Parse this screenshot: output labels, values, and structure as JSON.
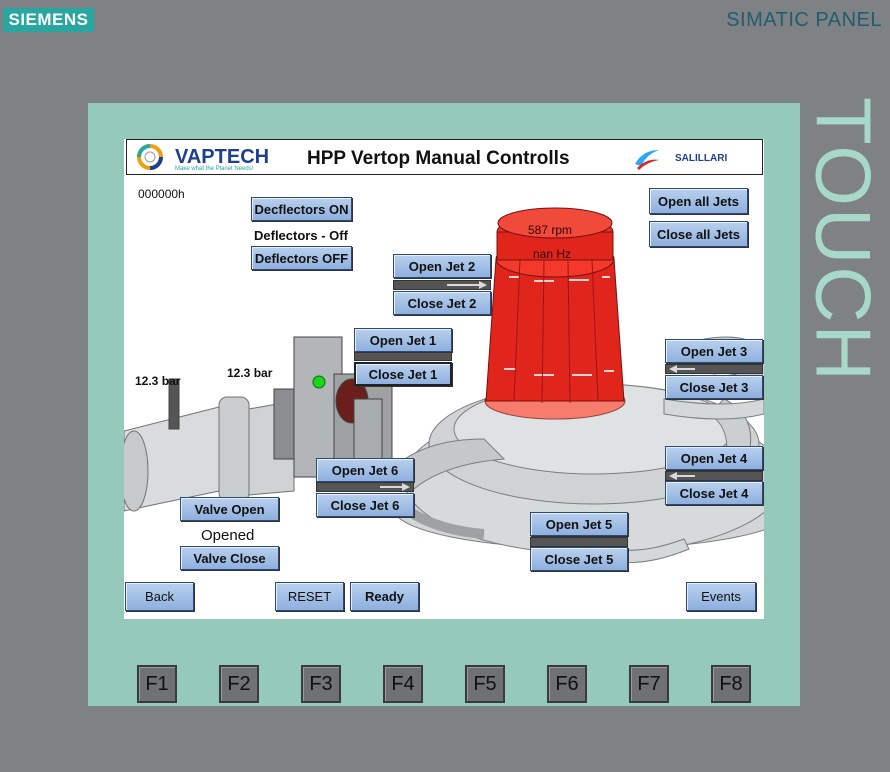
{
  "bezel": {
    "brand": "SIEMENS",
    "panel_name": "SIMATIC PANEL",
    "touch_label": "TOUCH",
    "function_keys": [
      "F1",
      "F2",
      "F3",
      "F4",
      "F5",
      "F6",
      "F7",
      "F8"
    ]
  },
  "header": {
    "left_logo_name": "VAPTECH",
    "left_logo_tagline": "Make what the Planet Needs!",
    "title": "HPP Vertop Manual Controlls",
    "right_logo_name": "SALILLARI"
  },
  "status": {
    "counter": "000000h",
    "speed": "587 rpm",
    "frequency": "nan Hz",
    "pressure_1": "12.3 bar",
    "pressure_2": "12.3 bar",
    "deflectors_state": "Deflectors - Off",
    "valve_state": "Opened"
  },
  "deflectors": {
    "on_label": "Decflectors ON",
    "off_label": "Deflectors OFF"
  },
  "all_jets": {
    "open_label": "Open all Jets",
    "close_label": "Close all Jets"
  },
  "jets": {
    "jet1": {
      "open": "Open Jet 1",
      "close": "Close Jet 1",
      "position": 0
    },
    "jet2": {
      "open": "Open Jet 2",
      "close": "Close Jet 2",
      "position": 0
    },
    "jet3": {
      "open": "Open Jet 3",
      "close": "Close Jet 3",
      "position": 0
    },
    "jet4": {
      "open": "Open Jet 4",
      "close": "Close Jet 4",
      "position": 0
    },
    "jet5": {
      "open": "Open Jet 5",
      "close": "Close Jet 5",
      "position": 0
    },
    "jet6": {
      "open": "Open Jet 6",
      "close": "Close Jet 6",
      "position": 0
    }
  },
  "valve": {
    "open_label": "Valve Open",
    "close_label": "Valve Close"
  },
  "footer": {
    "back": "Back",
    "reset": "RESET",
    "ready": "Ready",
    "events": "Events"
  },
  "colors": {
    "bezel": "#7f8285",
    "frame": "#95c9b9",
    "button": "#9fbfe6",
    "generator": "#e0251c",
    "indicator_ok": "#18d61a",
    "brand": "#2aa6a0"
  }
}
